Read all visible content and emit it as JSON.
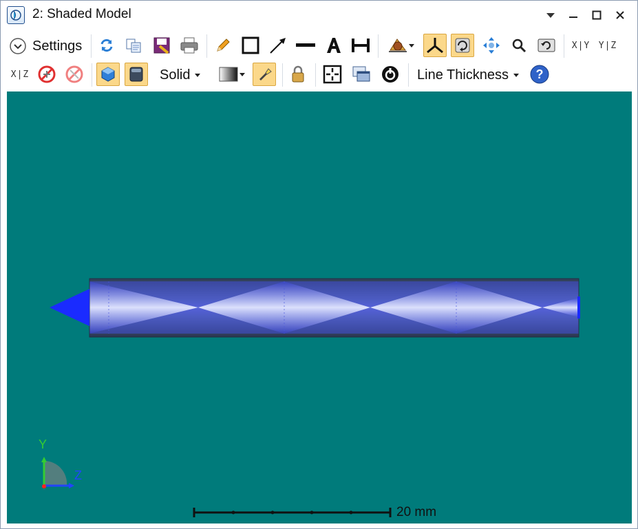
{
  "window": {
    "title": "2: Shaded Model",
    "controls": [
      "menu-dropdown",
      "minimize",
      "maximize",
      "close"
    ]
  },
  "toolbar_row1": {
    "settings_label": "Settings",
    "tools": [
      "refresh",
      "copy",
      "save",
      "print",
      "pencil",
      "rectangle",
      "arrow",
      "line",
      "text",
      "dimension",
      "camera",
      "axes-view",
      "rotate-view",
      "pan",
      "zoom",
      "reset-view"
    ],
    "active_tools": [
      "axes-view",
      "rotate-view"
    ],
    "view_xy": "X|Y",
    "view_yz": "Y|Z"
  },
  "toolbar_row2": {
    "view_xz": "X|Z",
    "render_mode_label": "Solid",
    "line_thickness_label": "Line Thickness",
    "active_tools": [
      "solid-shading",
      "surface",
      "flashlight"
    ]
  },
  "viewport": {
    "background_color": "#007b7b",
    "axis_y_label": "Y",
    "axis_z_label": "Z",
    "scale_bar_label": "20 mm"
  },
  "colors": {
    "active_button_bg": "#fbd88a",
    "rod_blue": "#1a2bff",
    "axis_y": "#33cc33",
    "axis_z": "#2244ff",
    "axis_x": "#ff2222"
  }
}
